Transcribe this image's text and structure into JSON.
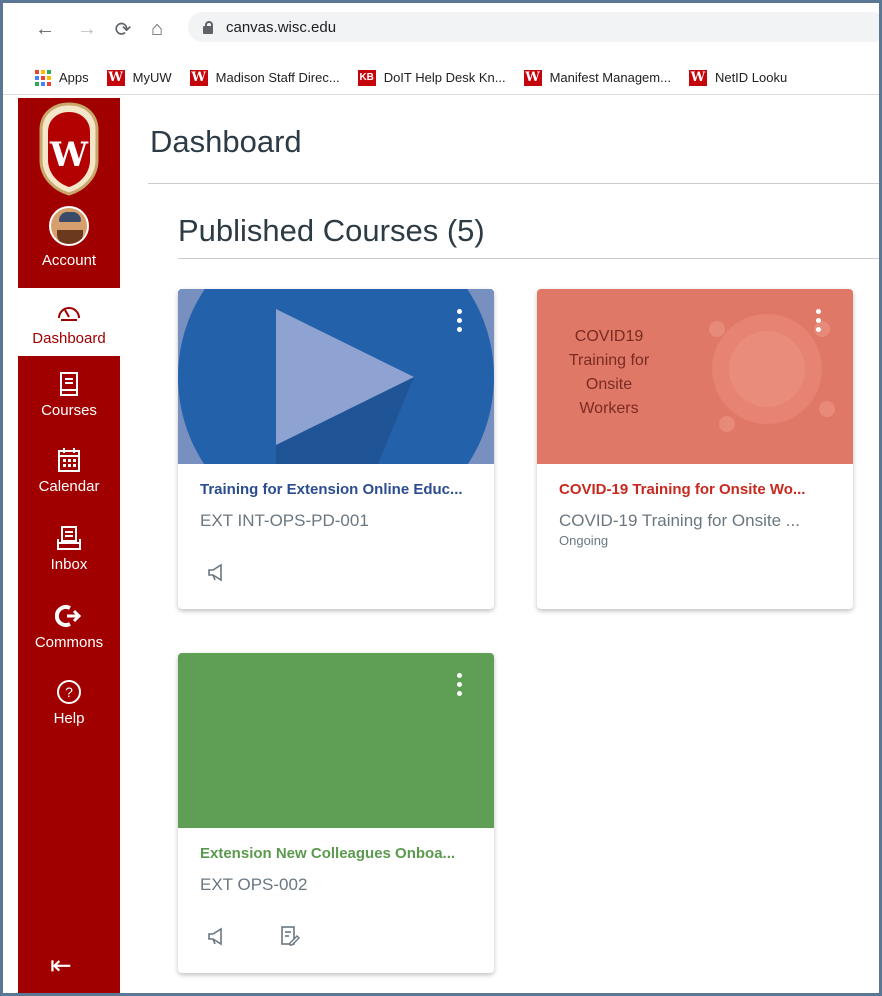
{
  "browser": {
    "url": "canvas.wisc.edu",
    "bookmarks": [
      {
        "label": "Apps"
      },
      {
        "label": "MyUW",
        "icon": "W"
      },
      {
        "label": "Madison Staff Direc...",
        "icon": "W"
      },
      {
        "label": "DoIT Help Desk Kn...",
        "icon": "KB"
      },
      {
        "label": "Manifest Managem...",
        "icon": "W"
      },
      {
        "label": "NetID Looku",
        "icon": "W"
      }
    ]
  },
  "sidebar": {
    "items": [
      {
        "label": "Account",
        "icon": "avatar"
      },
      {
        "label": "Dashboard",
        "icon": "dashboard-icon"
      },
      {
        "label": "Courses",
        "icon": "courses-icon"
      },
      {
        "label": "Calendar",
        "icon": "calendar-icon"
      },
      {
        "label": "Inbox",
        "icon": "inbox-icon"
      },
      {
        "label": "Commons",
        "icon": "commons-icon"
      },
      {
        "label": "Help",
        "icon": "help-icon"
      }
    ],
    "active": "Dashboard",
    "brand_color": "#a00000"
  },
  "main": {
    "page_title": "Dashboard",
    "section_title": "Published Courses (5)",
    "cards": [
      {
        "title": "Training for Extension Online Educ...",
        "code": "EXT INT-OPS-PD-001",
        "term": "",
        "color": "#2b4d8f",
        "hero_color": "#2461ab"
      },
      {
        "title": "COVID-19 Training for Onsite Wo...",
        "code": "COVID-19 Training for Onsite ...",
        "term": "Ongoing",
        "color": "#c8291f",
        "hero_color": "#e07868",
        "hero_text": [
          "COVID19",
          "Training for",
          "Onsite",
          "Workers"
        ]
      },
      {
        "title": "Extension New Colleagues Onboa...",
        "code": "EXT OPS-002",
        "term": "",
        "color": "#5b9a4e",
        "hero_color": "#5f9f55"
      }
    ]
  }
}
